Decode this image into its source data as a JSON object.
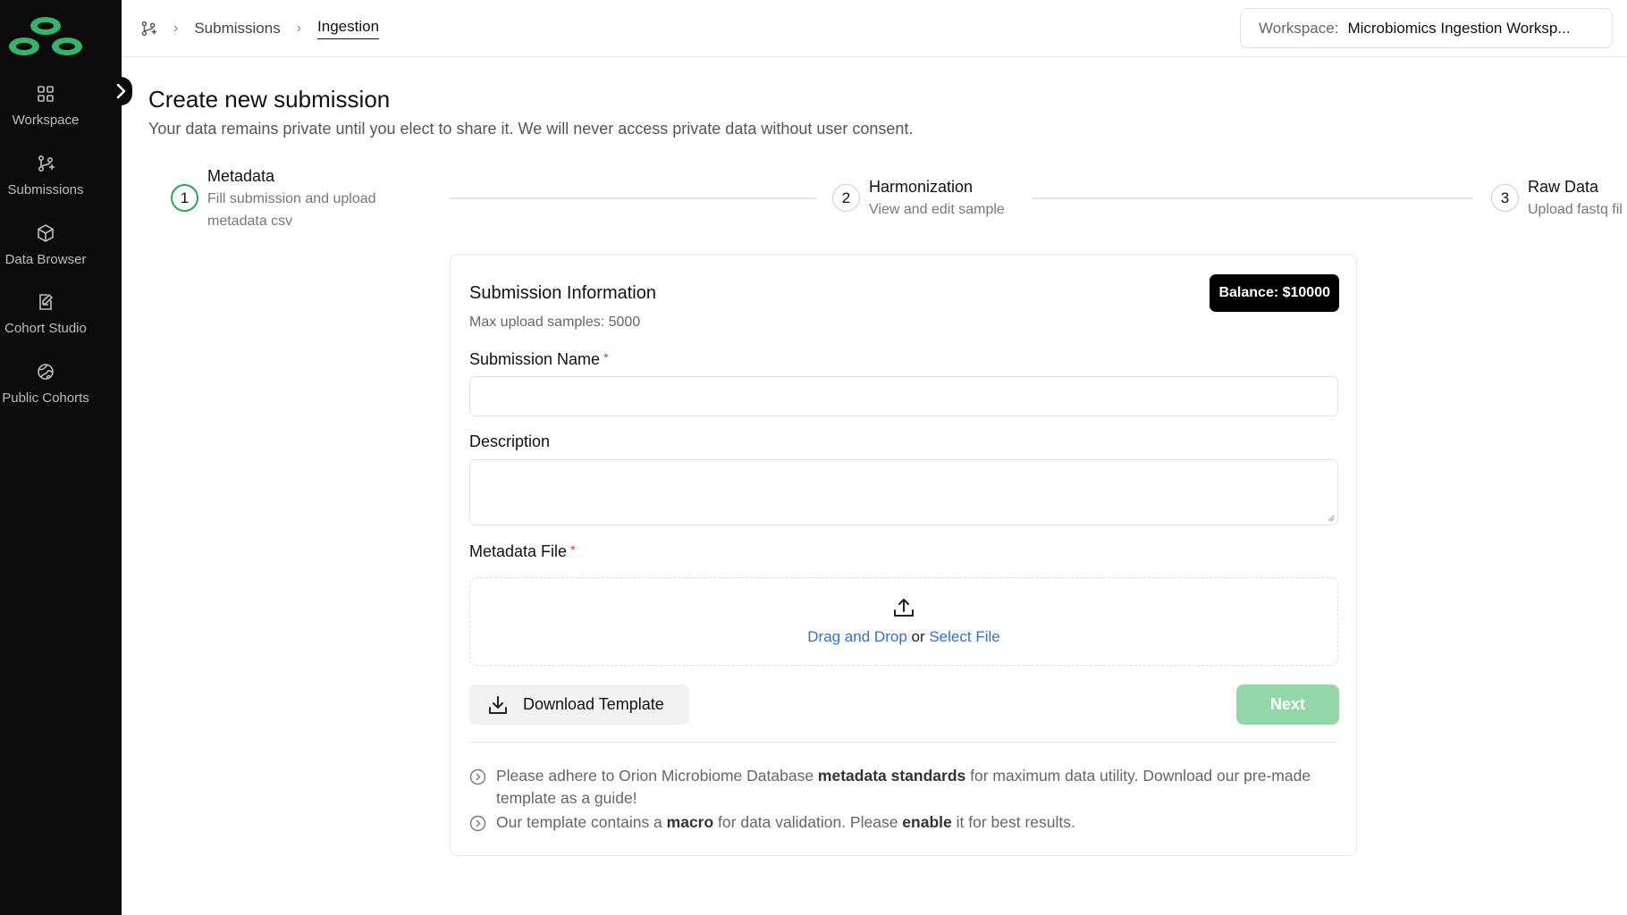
{
  "sidebar": {
    "collapse_icon": "chevron-right-icon",
    "items": [
      {
        "label": "Workspace",
        "icon": "grid-icon"
      },
      {
        "label": "Submissions",
        "icon": "git-branch-icon"
      },
      {
        "label": "Data Browser",
        "icon": "cube-icon"
      },
      {
        "label": "Cohort Studio",
        "icon": "edit-document-icon"
      },
      {
        "label": "Public Cohorts",
        "icon": "globe-icon"
      }
    ]
  },
  "header": {
    "breadcrumb": [
      "Submissions",
      "Ingestion"
    ],
    "workspace_label": "Workspace:",
    "workspace_value": "Microbiomics Ingestion Worksp..."
  },
  "page": {
    "title": "Create new submission",
    "subtitle": "Your data remains private until you elect to share it. We will never access private data without user consent."
  },
  "stepper": [
    {
      "number": "1",
      "title": "Metadata",
      "desc_line1": "Fill submission and upload",
      "desc_line2": "metadata csv",
      "state": "active"
    },
    {
      "number": "2",
      "title": "Harmonization",
      "desc_line1": "View and edit sample",
      "state": "pending"
    },
    {
      "number": "3",
      "title": "Raw Data",
      "desc_line1": "Upload fastq fil",
      "state": "pending"
    }
  ],
  "form": {
    "title": "Submission Information",
    "max_samples": "Max upload samples: 5000",
    "balance": "Balance: $10000",
    "name_label": "Submission Name",
    "required_mark": "*",
    "name_value": "",
    "description_label": "Description",
    "description_value": "",
    "file_label": "Metadata File",
    "drop_drag": "Drag and Drop",
    "drop_or": " or ",
    "drop_select": "Select File",
    "download_label": "Download Template",
    "next_label": "Next",
    "notes": [
      {
        "pre": "Please adhere to Orion Microbiome Database ",
        "bold": "metadata standards",
        "post": " for maximum data utility. Download our pre-made template as a guide!"
      },
      {
        "pre": "Our template contains a ",
        "bold": "macro",
        "mid": " for data validation. Please ",
        "bold2": "enable",
        "post": " it for best results."
      }
    ]
  },
  "colors": {
    "sidebar_bg": "#0b0b0b",
    "accent_green": "#2fa35a",
    "next_button": "#93d6a8",
    "link_blue": "#2f6fd6",
    "required_red": "#d23a3a"
  }
}
